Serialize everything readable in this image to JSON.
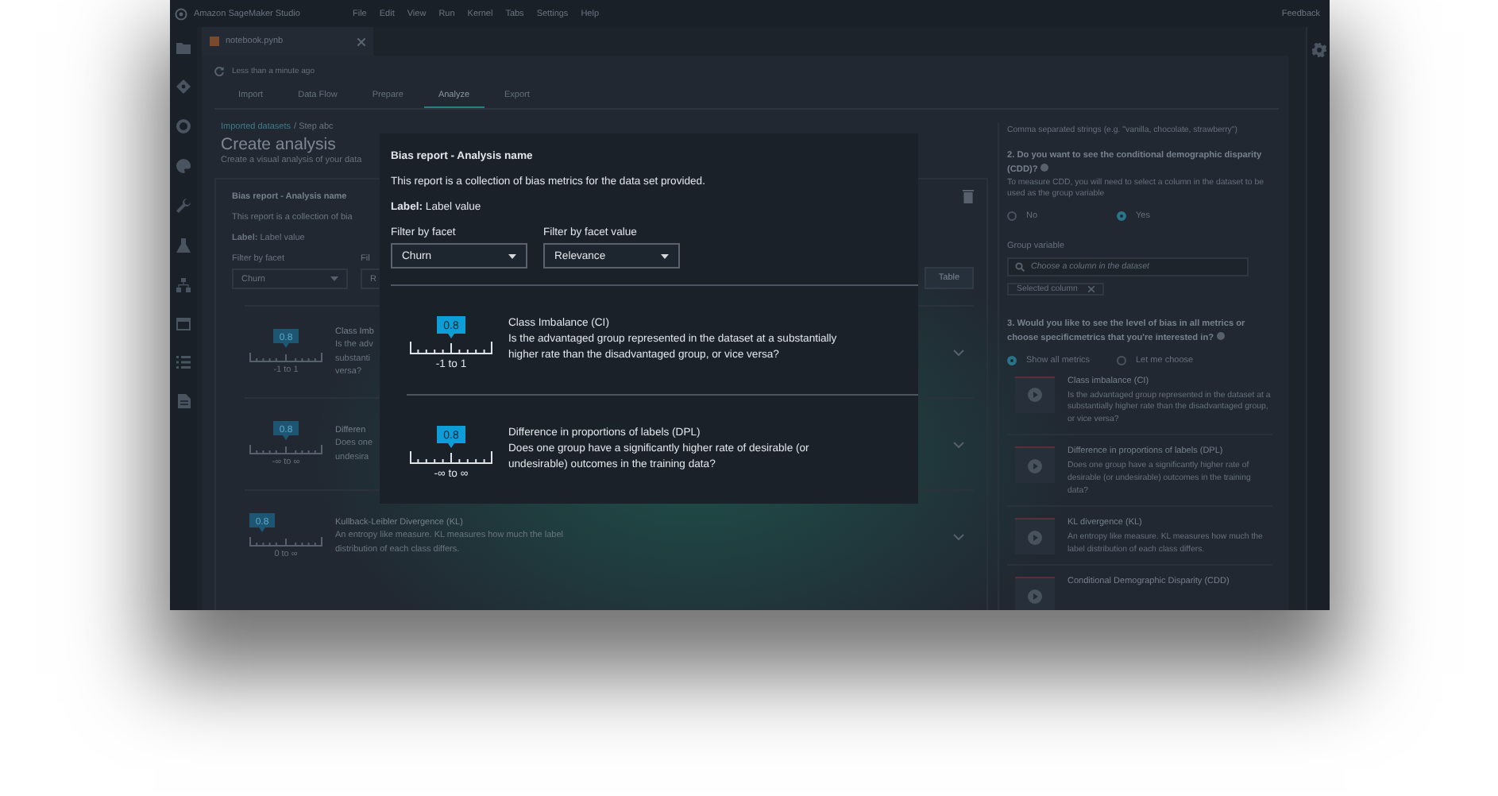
{
  "app": {
    "title": "Amazon SageMaker Studio",
    "menu": [
      "File",
      "Edit",
      "View",
      "Run",
      "Kernel",
      "Tabs",
      "Settings",
      "Help"
    ],
    "feedback": "Feedback"
  },
  "file_tab": {
    "label": "notebook.pynb"
  },
  "status": "Less than a minute ago",
  "tabs": [
    {
      "label": "Import",
      "selected": false
    },
    {
      "label": "Data Flow",
      "selected": false
    },
    {
      "label": "Prepare",
      "selected": false
    },
    {
      "label": "Analyze",
      "selected": true
    },
    {
      "label": "Export",
      "selected": false
    }
  ],
  "breadcrumb": {
    "link": "Imported datasets",
    "current": "/ Step abc"
  },
  "page_title": "Create analysis",
  "page_subtitle": "Create a visual analysis of your data",
  "report_card": {
    "title": "Bias report - Analysis name",
    "description": "This report is a collection of bia",
    "label": "**Label:** Label value",
    "filters": [
      {
        "label": "Filter by facet",
        "value": "Churn"
      },
      {
        "label": "Fil",
        "value": "R"
      }
    ],
    "table_button": "Table",
    "metrics": [
      {
        "badge": "0.8",
        "kind": "centered",
        "range": "-1 to 1",
        "title": "Class Imb",
        "lines": [
          "Is the adv",
          "substanti",
          "versa?"
        ]
      },
      {
        "badge": "0.8",
        "kind": "centered",
        "range": "-∞ to ∞",
        "title": "Differen",
        "lines": [
          "Does one",
          "undesira"
        ]
      },
      {
        "badge": "0.8",
        "kind": "left",
        "range": "0 to ∞",
        "title": "Kullback-Leibler Divergence (KL)",
        "lines": [
          "An entropy like measure. KL measures how much the label",
          "distribution of each class differs."
        ]
      }
    ]
  },
  "settings_panel": {
    "hint": "Comma separated strings (e.g. \"vanilla, chocolate, strawberry\")",
    "cdd_question": "2. Do you want to see the conditional demographic disparity (CDD)?",
    "cdd_description": "To measure CDD, you will need to select a column in the dataset to be used as the group variable",
    "cdd_options": [
      {
        "label": "No",
        "selected": false
      },
      {
        "label": "Yes",
        "selected": true
      }
    ],
    "group_label": "Group variable",
    "group_search": {
      "placeholder": "Choose a column in the dataset"
    },
    "group_token": "Selected column",
    "metrics_question": "3. Would you like to see the level of bias in all metrics or choose specificmetrics that you're interested in?",
    "metrics_options": [
      {
        "label": "Show all metrics",
        "selected": true
      },
      {
        "label": "Let me choose",
        "selected": false
      }
    ],
    "metrics": [
      {
        "title": "Class imbalance (CI)",
        "description": "Is the advantaged group represented in the dataset at a substantially higher rate than the disadvantaged group, or vice versa?"
      },
      {
        "title": "Difference in proportions of labels (DPL)",
        "description": "Does one group have a significantly higher rate of desirable (or undesirable) outcomes in the training data?"
      },
      {
        "title": "KL divergence (KL)",
        "description": "An entropy like measure. KL measures how much the label distribution of each class differs."
      },
      {
        "title": "Conditional Demographic Disparity (CDD)"
      }
    ]
  },
  "dialog": {
    "title": "Bias report - Analysis name",
    "description": "This report is a collection of bias metrics for the data set provided.",
    "label": "**Label:** Label value",
    "filters": [
      {
        "label": "Filter by facet",
        "value": "Churn"
      },
      {
        "label": "Filter by facet value",
        "value": "Relevance"
      }
    ],
    "metrics": [
      {
        "badge": "0.8",
        "range": "-1 to 1",
        "title": "Class Imbalance (CI)",
        "description": "Is the advantaged group represented in the dataset at a substantially higher rate than the disadvantaged group, or vice versa?"
      },
      {
        "badge": "0.8",
        "range": "-∞ to ∞",
        "title": "Difference in proportions of labels (DPL)",
        "description": "Does one group have a significantly higher rate of desirable (or undesirable) outcomes in the training data?"
      }
    ]
  }
}
